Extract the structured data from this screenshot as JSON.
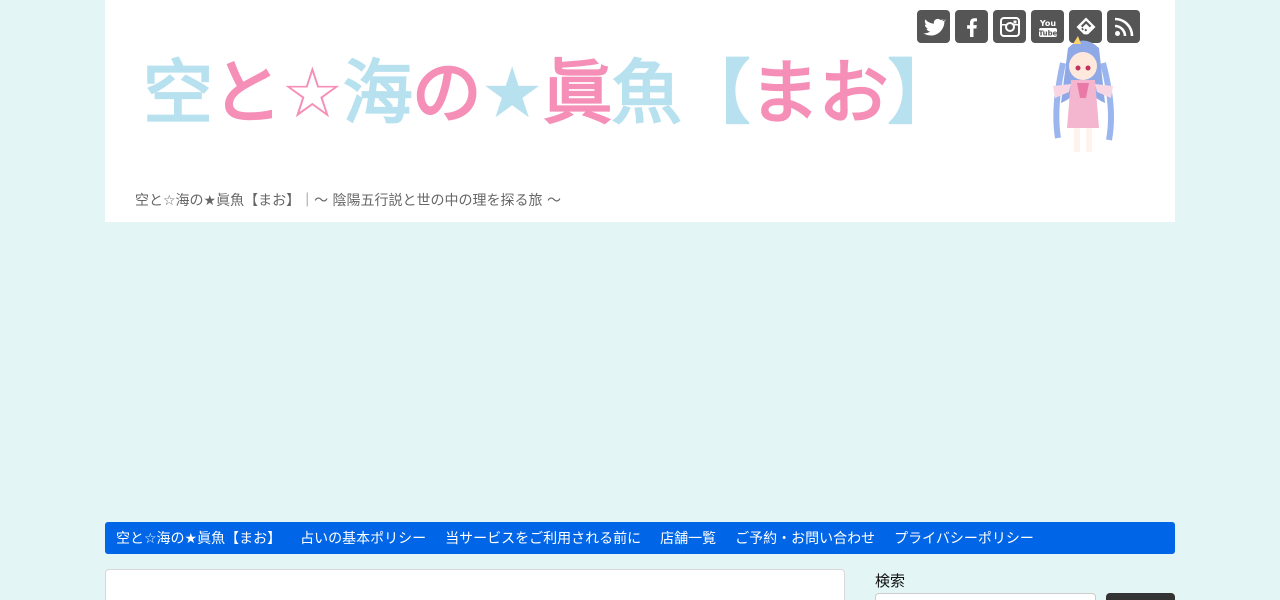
{
  "header": {
    "logo_text_parts": [
      {
        "text": "空",
        "color": "#b8e1ef"
      },
      {
        "text": "と",
        "color": "#f58fb7"
      },
      {
        "text": "☆",
        "color": "#f58fb7"
      },
      {
        "text": "海",
        "color": "#b8e1ef"
      },
      {
        "text": "の",
        "color": "#f58fb7"
      },
      {
        "text": "★",
        "color": "#b8e1ef"
      },
      {
        "text": "眞",
        "color": "#f58fb7"
      },
      {
        "text": "魚",
        "color": "#b8e1ef"
      },
      {
        "text": "【",
        "color": "#b8e1ef"
      },
      {
        "text": "まお",
        "color": "#f58fb7"
      },
      {
        "text": "】",
        "color": "#b8e1ef"
      }
    ],
    "tagline": "空と☆海の★眞魚【まお】｜～ 陰陽五行説と世の中の理を探る旅 ～",
    "social_icons": [
      "twitter-icon",
      "facebook-icon",
      "instagram-icon",
      "youtube-icon",
      "feedly-icon",
      "rss-icon"
    ]
  },
  "nav": {
    "items": [
      "空と☆海の★眞魚【まお】",
      "占いの基本ポリシー",
      "当サービスをご利用される前に",
      "店舗一覧",
      "ご予約・お問い合わせ",
      "プライバシーポリシー"
    ]
  },
  "sidebar": {
    "search_title": "検索"
  },
  "colors": {
    "background": "#e3f6f5",
    "nav": "#0065e6",
    "pink": "#f58fb7",
    "light_blue": "#b8e1ef",
    "icon_gray": "#555555"
  }
}
